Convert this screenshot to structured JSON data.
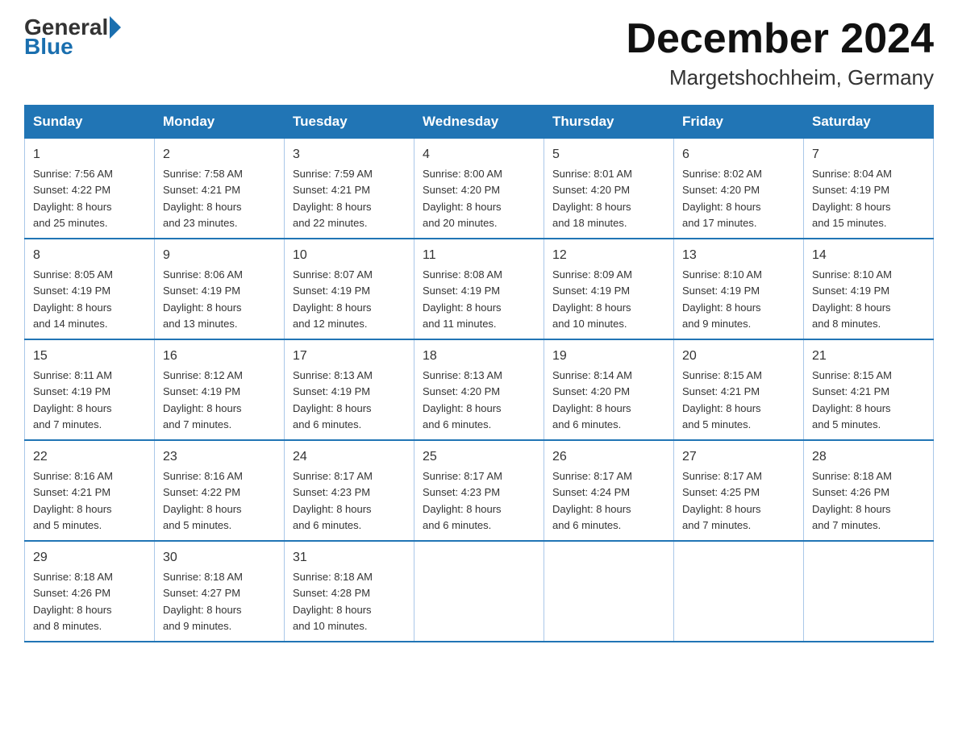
{
  "header": {
    "logo_general": "General",
    "logo_blue": "Blue",
    "month_title": "December 2024",
    "location": "Margetshochheim, Germany"
  },
  "days_of_week": [
    "Sunday",
    "Monday",
    "Tuesday",
    "Wednesday",
    "Thursday",
    "Friday",
    "Saturday"
  ],
  "weeks": [
    [
      {
        "num": "1",
        "sunrise": "7:56 AM",
        "sunset": "4:22 PM",
        "daylight": "8 hours and 25 minutes."
      },
      {
        "num": "2",
        "sunrise": "7:58 AM",
        "sunset": "4:21 PM",
        "daylight": "8 hours and 23 minutes."
      },
      {
        "num": "3",
        "sunrise": "7:59 AM",
        "sunset": "4:21 PM",
        "daylight": "8 hours and 22 minutes."
      },
      {
        "num": "4",
        "sunrise": "8:00 AM",
        "sunset": "4:20 PM",
        "daylight": "8 hours and 20 minutes."
      },
      {
        "num": "5",
        "sunrise": "8:01 AM",
        "sunset": "4:20 PM",
        "daylight": "8 hours and 18 minutes."
      },
      {
        "num": "6",
        "sunrise": "8:02 AM",
        "sunset": "4:20 PM",
        "daylight": "8 hours and 17 minutes."
      },
      {
        "num": "7",
        "sunrise": "8:04 AM",
        "sunset": "4:19 PM",
        "daylight": "8 hours and 15 minutes."
      }
    ],
    [
      {
        "num": "8",
        "sunrise": "8:05 AM",
        "sunset": "4:19 PM",
        "daylight": "8 hours and 14 minutes."
      },
      {
        "num": "9",
        "sunrise": "8:06 AM",
        "sunset": "4:19 PM",
        "daylight": "8 hours and 13 minutes."
      },
      {
        "num": "10",
        "sunrise": "8:07 AM",
        "sunset": "4:19 PM",
        "daylight": "8 hours and 12 minutes."
      },
      {
        "num": "11",
        "sunrise": "8:08 AM",
        "sunset": "4:19 PM",
        "daylight": "8 hours and 11 minutes."
      },
      {
        "num": "12",
        "sunrise": "8:09 AM",
        "sunset": "4:19 PM",
        "daylight": "8 hours and 10 minutes."
      },
      {
        "num": "13",
        "sunrise": "8:10 AM",
        "sunset": "4:19 PM",
        "daylight": "8 hours and 9 minutes."
      },
      {
        "num": "14",
        "sunrise": "8:10 AM",
        "sunset": "4:19 PM",
        "daylight": "8 hours and 8 minutes."
      }
    ],
    [
      {
        "num": "15",
        "sunrise": "8:11 AM",
        "sunset": "4:19 PM",
        "daylight": "8 hours and 7 minutes."
      },
      {
        "num": "16",
        "sunrise": "8:12 AM",
        "sunset": "4:19 PM",
        "daylight": "8 hours and 7 minutes."
      },
      {
        "num": "17",
        "sunrise": "8:13 AM",
        "sunset": "4:19 PM",
        "daylight": "8 hours and 6 minutes."
      },
      {
        "num": "18",
        "sunrise": "8:13 AM",
        "sunset": "4:20 PM",
        "daylight": "8 hours and 6 minutes."
      },
      {
        "num": "19",
        "sunrise": "8:14 AM",
        "sunset": "4:20 PM",
        "daylight": "8 hours and 6 minutes."
      },
      {
        "num": "20",
        "sunrise": "8:15 AM",
        "sunset": "4:21 PM",
        "daylight": "8 hours and 5 minutes."
      },
      {
        "num": "21",
        "sunrise": "8:15 AM",
        "sunset": "4:21 PM",
        "daylight": "8 hours and 5 minutes."
      }
    ],
    [
      {
        "num": "22",
        "sunrise": "8:16 AM",
        "sunset": "4:21 PM",
        "daylight": "8 hours and 5 minutes."
      },
      {
        "num": "23",
        "sunrise": "8:16 AM",
        "sunset": "4:22 PM",
        "daylight": "8 hours and 5 minutes."
      },
      {
        "num": "24",
        "sunrise": "8:17 AM",
        "sunset": "4:23 PM",
        "daylight": "8 hours and 6 minutes."
      },
      {
        "num": "25",
        "sunrise": "8:17 AM",
        "sunset": "4:23 PM",
        "daylight": "8 hours and 6 minutes."
      },
      {
        "num": "26",
        "sunrise": "8:17 AM",
        "sunset": "4:24 PM",
        "daylight": "8 hours and 6 minutes."
      },
      {
        "num": "27",
        "sunrise": "8:17 AM",
        "sunset": "4:25 PM",
        "daylight": "8 hours and 7 minutes."
      },
      {
        "num": "28",
        "sunrise": "8:18 AM",
        "sunset": "4:26 PM",
        "daylight": "8 hours and 7 minutes."
      }
    ],
    [
      {
        "num": "29",
        "sunrise": "8:18 AM",
        "sunset": "4:26 PM",
        "daylight": "8 hours and 8 minutes."
      },
      {
        "num": "30",
        "sunrise": "8:18 AM",
        "sunset": "4:27 PM",
        "daylight": "8 hours and 9 minutes."
      },
      {
        "num": "31",
        "sunrise": "8:18 AM",
        "sunset": "4:28 PM",
        "daylight": "8 hours and 10 minutes."
      },
      null,
      null,
      null,
      null
    ]
  ],
  "labels": {
    "sunrise": "Sunrise:",
    "sunset": "Sunset:",
    "daylight": "Daylight:"
  }
}
